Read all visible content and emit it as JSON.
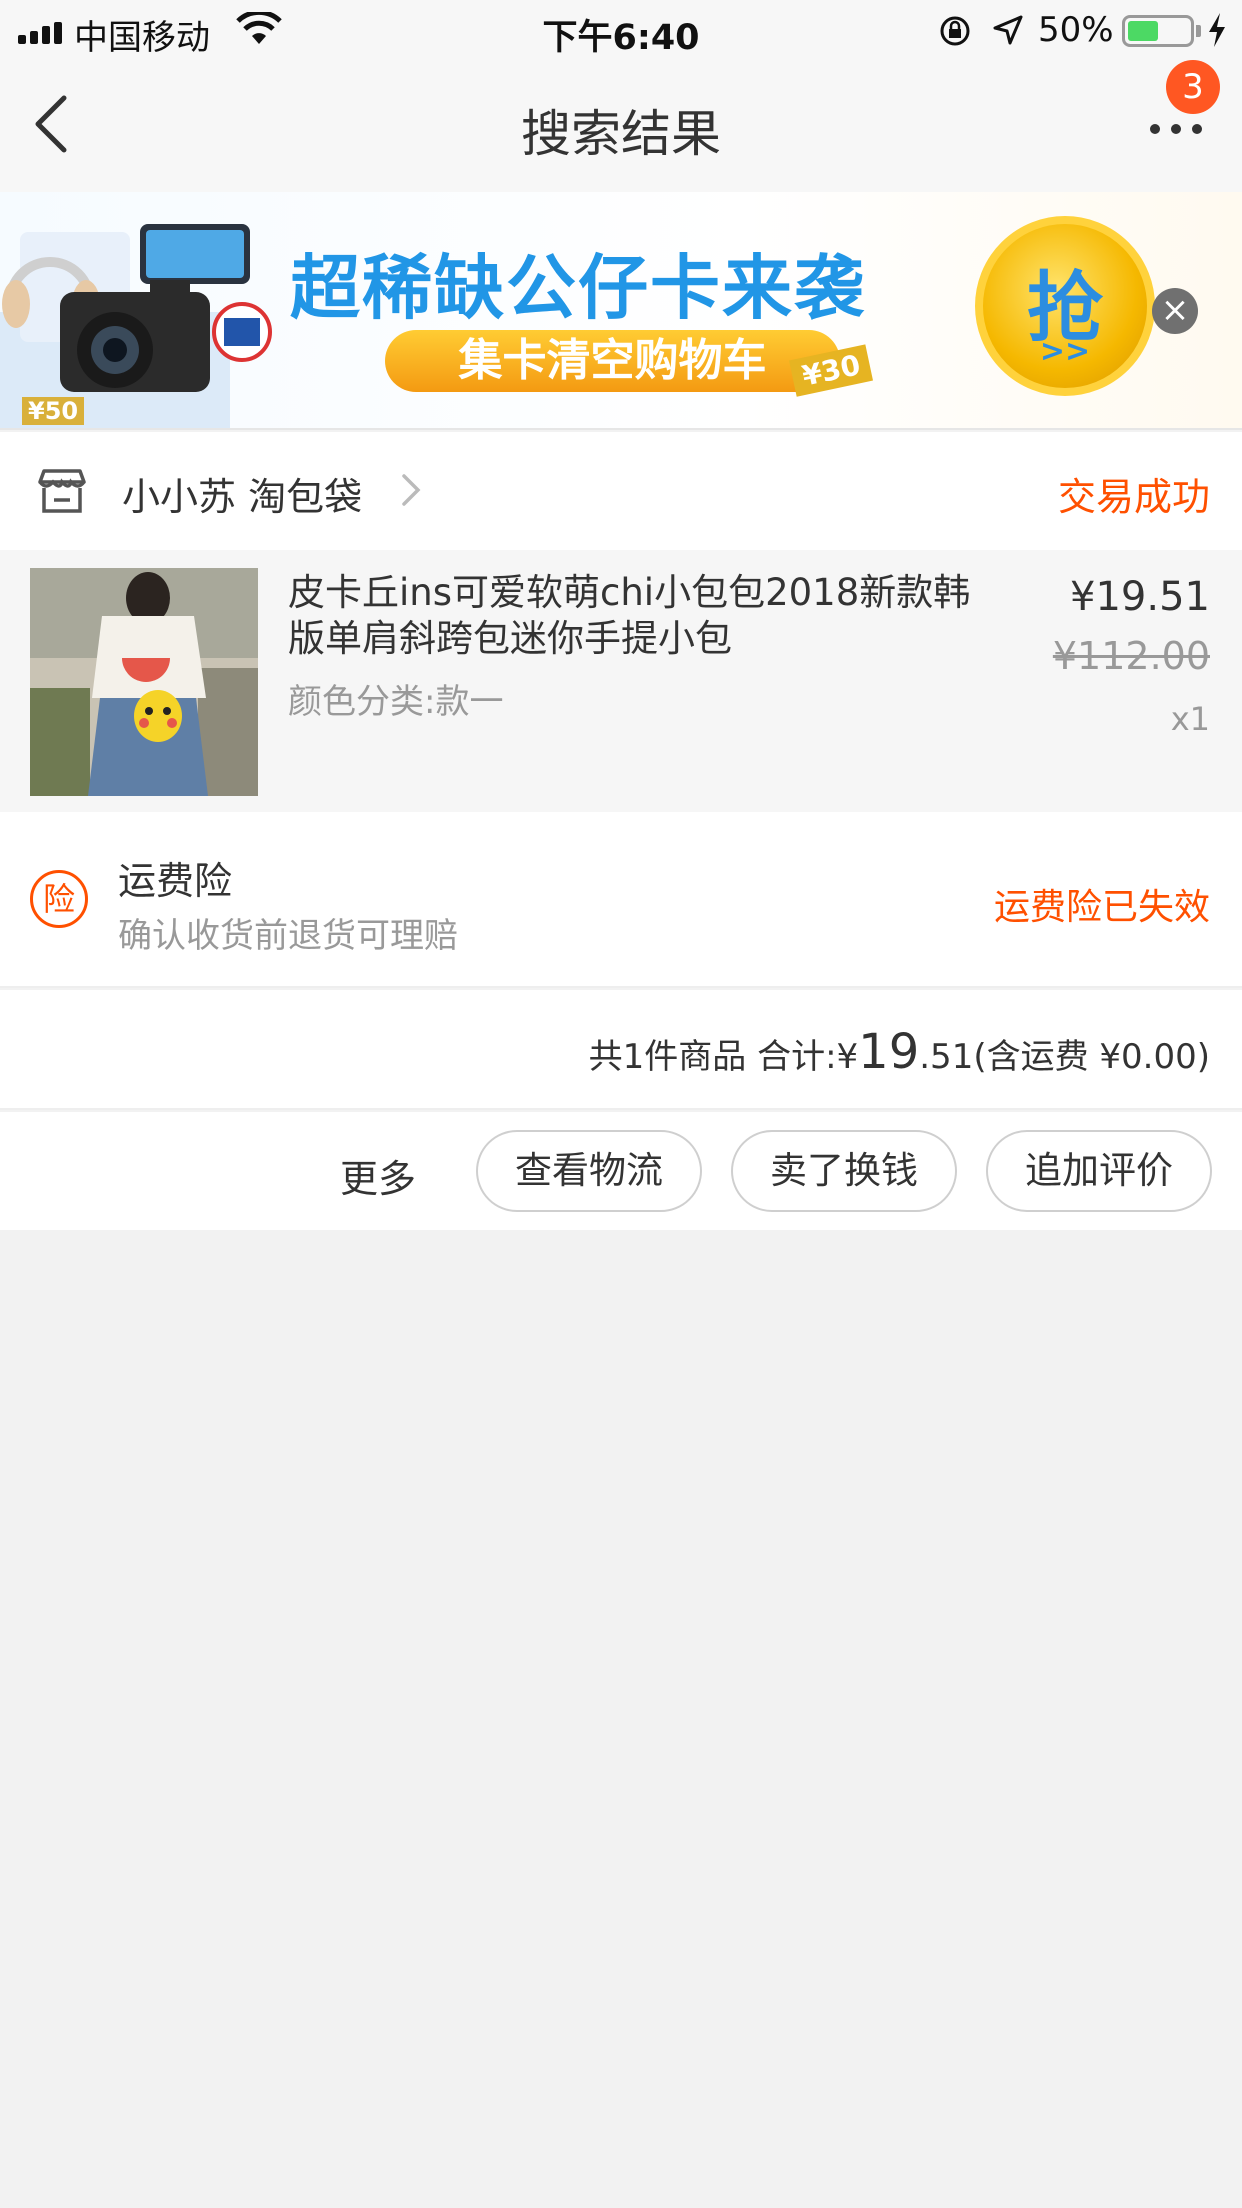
{
  "status_bar": {
    "carrier": "中国移动",
    "time": "下午6:40",
    "battery": "50%",
    "battery_level": 0.5
  },
  "nav": {
    "title": "搜索结果",
    "badge_count": "3"
  },
  "banner": {
    "headline": "超稀缺公仔卡来袭",
    "subline": "集卡清空购物车",
    "coupon": "¥30",
    "coupon_small": "¥50",
    "grab_label": "抢",
    "grab_arrows": ">>"
  },
  "shop": {
    "name": "小小苏 淘包袋",
    "status": "交易成功"
  },
  "product": {
    "title": "皮卡丘ins可爱软萌chi小包包2018新款韩版单肩斜跨包迷你手提小包",
    "sku": "颜色分类:款一",
    "price": "¥19.51",
    "original_price": "¥112.00",
    "quantity": "x1"
  },
  "insurance": {
    "icon_label": "险",
    "title": "运费险",
    "description": "确认收货前退货可理赔",
    "status": "运费险已失效"
  },
  "total": {
    "count_text": "共1件商品 合计:",
    "currency": "¥",
    "integer": "19",
    "decimal": ".51",
    "shipping": "(含运费 ¥0.00)"
  },
  "actions": {
    "more": "更多",
    "logistics": "查看物流",
    "resell": "卖了换钱",
    "review": "追加评价"
  },
  "colors": {
    "accent": "#ff5000",
    "badge": "#ff5722",
    "banner_blue": "#2196e6"
  }
}
